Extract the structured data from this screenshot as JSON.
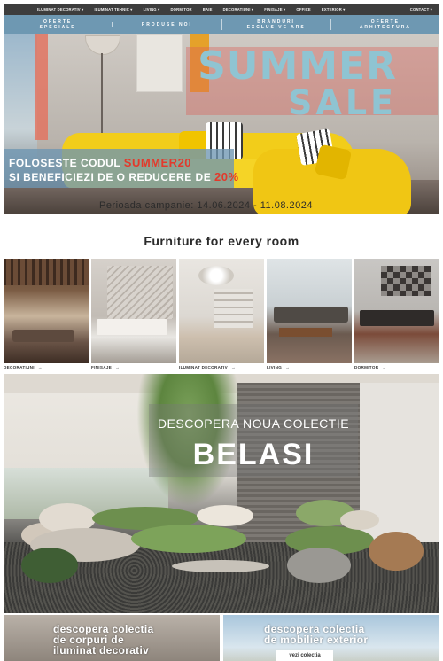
{
  "topnav": {
    "items": [
      "ILUMINAT DECORATIV",
      "ILUMINAT TEHNIC",
      "LIVING",
      "DORMITOR",
      "BAIE",
      "DECORATIUNI",
      "FINISAJE",
      "OFFICE",
      "EXTERIOR"
    ],
    "contact": "CONTACT"
  },
  "ribbon": {
    "cells": [
      [
        "OFERTE",
        "SPECIALE"
      ],
      [
        "PRODUSE NOI",
        ""
      ],
      [
        "BRANDURI",
        "EXCLUSIVE ARS"
      ],
      [
        "OFERTE",
        "ARHITECTURA"
      ]
    ]
  },
  "hero": {
    "summer": "SUMMER",
    "sale": "SALE",
    "promo_line1_prefix": "FOLOSESTE CODUL",
    "promo_code": "SUMMER20",
    "promo_line2_prefix": "SI BENEFICIEZI DE O REDUCERE DE",
    "promo_discount": "20%",
    "period": "Perioada campanie: 14.06.2024 - 11.08.2024"
  },
  "section": {
    "title": "Furniture for every room"
  },
  "categories": [
    {
      "label": "DECORATIUNI",
      "arrow": "→"
    },
    {
      "label": "FINISAJE",
      "arrow": "→"
    },
    {
      "label": "ILUMINAT DECORATIV",
      "arrow": "→"
    },
    {
      "label": "LIVING",
      "arrow": "→"
    },
    {
      "label": "DORMITOR",
      "arrow": "→"
    }
  ],
  "collection": {
    "subtitle": "DESCOPERA NOUA COLECTIE",
    "name": "BELASI"
  },
  "banners": [
    {
      "text_line1": "descopera colectia",
      "text_line2": "de corpuri de",
      "text_line3": "iluminat decorativ",
      "cta": ""
    },
    {
      "text_line1": "descopera colectia",
      "text_line2": "de mobilier exterior",
      "text_line3": "",
      "cta": "vezi colectia"
    }
  ],
  "colors": {
    "nav_bg": "#3d3d3d",
    "ribbon_bg": "#6e98b2",
    "sale_text": "#8fc4d2",
    "accent_red": "#e23a2c",
    "sofa_yellow": "#f2cd1a"
  }
}
